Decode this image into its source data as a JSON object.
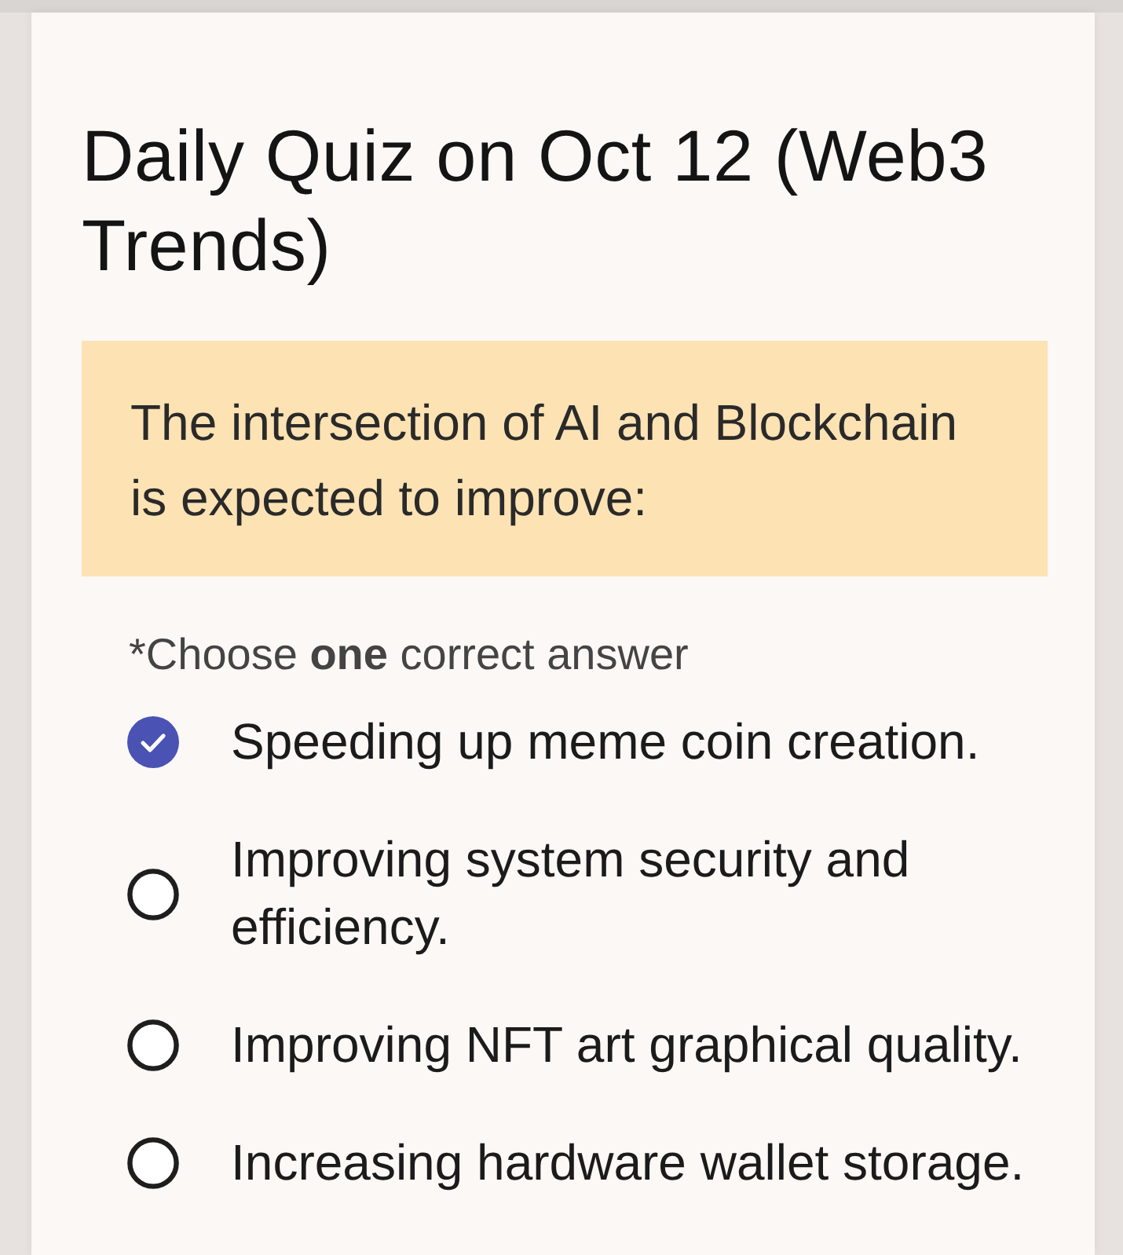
{
  "quiz": {
    "title": "Daily Quiz on Oct 12 (Web3 Trends)",
    "question": "The intersection of AI and Blockchain is expected to improve:",
    "instruction": "*Choose **one** correct answer",
    "options": [
      {
        "label": "Speeding up meme coin creation.",
        "selected": true
      },
      {
        "label": "Improving system security and efficiency.",
        "selected": false
      },
      {
        "label": "Improving NFT art graphical quality.",
        "selected": false
      },
      {
        "label": "Increasing hardware wallet storage.",
        "selected": false
      }
    ]
  }
}
